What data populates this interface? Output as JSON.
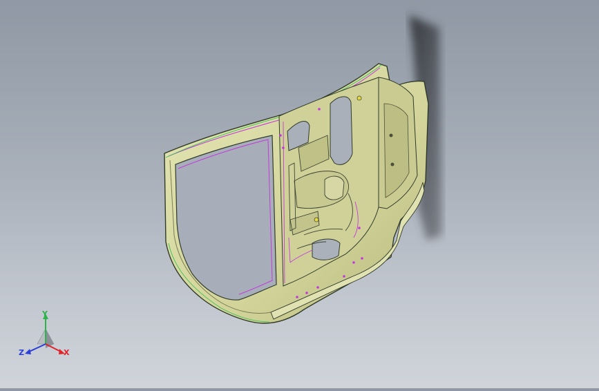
{
  "viewport": {
    "background_top": "#8f98a4",
    "background_bottom": "#d0d4da"
  },
  "model": {
    "part_fill": "#d8d9a3",
    "part_shade": "#b9bb7e",
    "edge_color": "#2f3a2a",
    "highlight_edge_color": "#c23bd8",
    "green_edge_color": "#3fbf5a",
    "shadow_color": "#3e4046"
  },
  "triad": {
    "x_label": "X",
    "y_label": "Y",
    "z_label": "Z",
    "x_color": "#e0242c",
    "y_color": "#2fb24a",
    "z_color": "#2a3fd6",
    "icon": "coordinate-triad-icon"
  }
}
